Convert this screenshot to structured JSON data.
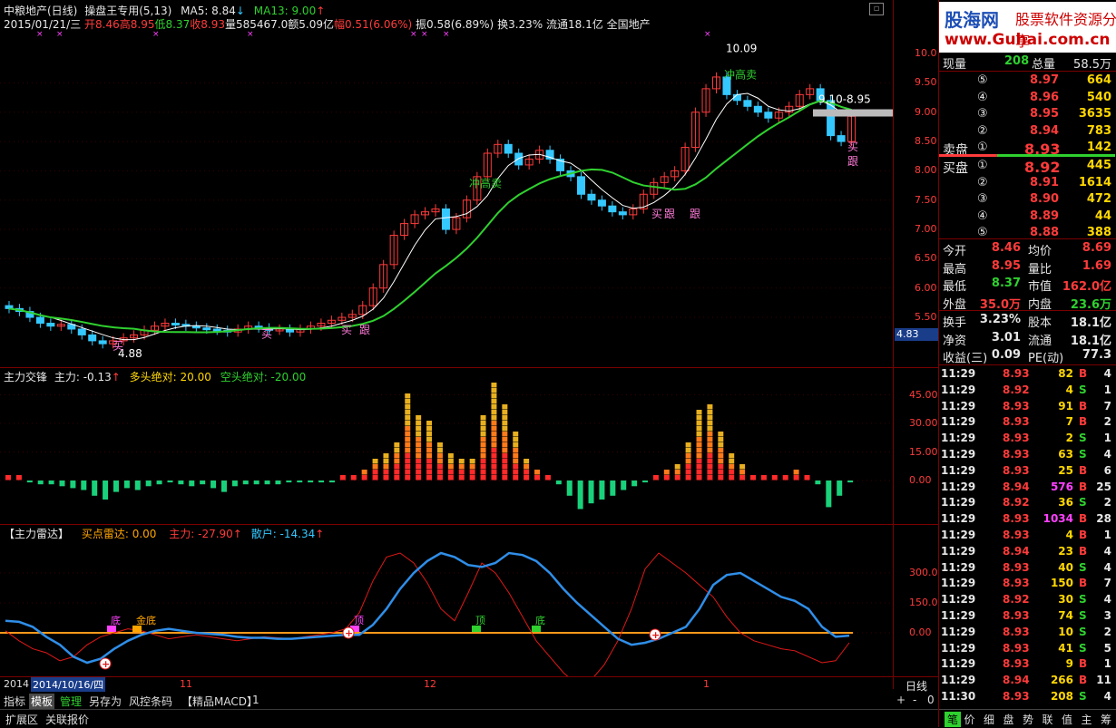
{
  "title": {
    "stock": "中粮地产(日线)",
    "template": "操盘王专用(5,13)",
    "ma5_label": "MA5: 8.84",
    "ma13_label": "MA13: 9.00"
  },
  "header2": {
    "date": "2015/01/21/三",
    "open": "开8.46",
    "high": "高8.95",
    "low": "低8.37",
    "close": "收8.93",
    "volume": "量585467.0",
    "amount": "额5.09亿",
    "change": "幅0.51(6.06%)",
    "amplitude": "振0.58(6.89%)",
    "turnover": "换3.23%",
    "float": "流通18.1亿",
    "sector": "全国地产"
  },
  "price_axis": [
    "10.0",
    "9.50",
    "9.00",
    "8.50",
    "8.00",
    "7.50",
    "7.00",
    "6.50",
    "6.00",
    "5.50"
  ],
  "price_current": "4.83",
  "annotations": {
    "high_peak": "10.09",
    "low_bottom": "4.88",
    "range": "9.10-8.95",
    "chonggaomai1": "冲高卖",
    "chonggaomai2": "冲高卖",
    "mai": "买",
    "gen": "跟"
  },
  "ind1": {
    "name": "主力交锋",
    "zhuli": "主力: -0.13",
    "duotou": "多头绝对: 20.00",
    "kongtou": "空头绝对: -20.00",
    "axis": [
      "45.00",
      "30.00",
      "15.00",
      "0.00"
    ]
  },
  "ind2": {
    "name": "【主力雷达】",
    "maidian": "买点雷达: 0.00",
    "zhuli": "主力: -27.90",
    "sanhu": "散户: -14.34",
    "axis": [
      "300.0",
      "150.0",
      "0.00"
    ],
    "markers": [
      "底",
      "金底",
      "顶",
      "顶",
      "底"
    ]
  },
  "date_axis": {
    "year": "2014",
    "cursor_date": "2014/10/16/四",
    "m11": "11",
    "m12": "12",
    "m1": "1",
    "period": "日线"
  },
  "toolbar": [
    "指标",
    "模板",
    "管理",
    "另存为",
    "风控条码",
    "【精品MACD】",
    "1"
  ],
  "toolbar_right": [
    "+",
    "-",
    "0"
  ],
  "bottom_tabs": [
    "扩展区",
    "关联报价"
  ],
  "side": {
    "logo": "股海网",
    "logo_sub": "股票软件资源分享",
    "url": "www.Guhai.com.cn",
    "xianliang_label": "现量",
    "xianliang": "208",
    "zongliang_label": "总量",
    "zongliang": "58.5万",
    "sell": [
      {
        "lvl": "⑤",
        "price": "8.97",
        "vol": "664"
      },
      {
        "lvl": "④",
        "price": "8.96",
        "vol": "540"
      },
      {
        "lvl": "③",
        "price": "8.95",
        "vol": "3635"
      },
      {
        "lvl": "②",
        "price": "8.94",
        "vol": "783"
      },
      {
        "lvl": "①",
        "price": "8.93",
        "vol": "142",
        "label": "卖盘"
      }
    ],
    "buy": [
      {
        "lvl": "①",
        "price": "8.92",
        "vol": "445",
        "label": "买盘"
      },
      {
        "lvl": "②",
        "price": "8.91",
        "vol": "1614"
      },
      {
        "lvl": "③",
        "price": "8.90",
        "vol": "472"
      },
      {
        "lvl": "④",
        "price": "8.89",
        "vol": "44"
      },
      {
        "lvl": "⑤",
        "price": "8.88",
        "vol": "388"
      }
    ],
    "stats": [
      {
        "l1": "今开",
        "v1": "8.46",
        "l2": "均价",
        "v2": "8.69"
      },
      {
        "l1": "最高",
        "v1": "8.95",
        "l2": "量比",
        "v2": "1.69"
      },
      {
        "l1": "最低",
        "v1": "8.37",
        "l2": "市值",
        "v2": "162.0亿"
      },
      {
        "l1": "外盘",
        "v1": "35.0万",
        "l2": "内盘",
        "v2": "23.6万"
      }
    ],
    "fin": [
      {
        "l1": "换手",
        "v1": "3.23%",
        "l2": "股本",
        "v2": "18.1亿"
      },
      {
        "l1": "净资",
        "v1": "3.01",
        "l2": "流通",
        "v2": "18.1亿"
      },
      {
        "l1": "收益(三)",
        "v1": "0.09",
        "l2": "PE(动)",
        "v2": "77.3"
      }
    ],
    "ticks": [
      [
        "11:29",
        "8.93",
        "82",
        "B",
        "4"
      ],
      [
        "11:29",
        "8.92",
        "4",
        "S",
        "1"
      ],
      [
        "11:29",
        "8.93",
        "91",
        "B",
        "7"
      ],
      [
        "11:29",
        "8.93",
        "7",
        "B",
        "2"
      ],
      [
        "11:29",
        "8.93",
        "2",
        "S",
        "1"
      ],
      [
        "11:29",
        "8.93",
        "63",
        "S",
        "4"
      ],
      [
        "11:29",
        "8.93",
        "25",
        "B",
        "6"
      ],
      [
        "11:29",
        "8.94",
        "576",
        "B",
        "25"
      ],
      [
        "11:29",
        "8.92",
        "36",
        "S",
        "2"
      ],
      [
        "11:29",
        "8.93",
        "1034",
        "B",
        "28"
      ],
      [
        "11:29",
        "8.93",
        "4",
        "B",
        "1"
      ],
      [
        "11:29",
        "8.94",
        "23",
        "B",
        "4"
      ],
      [
        "11:29",
        "8.93",
        "40",
        "S",
        "4"
      ],
      [
        "11:29",
        "8.93",
        "150",
        "B",
        "7"
      ],
      [
        "11:29",
        "8.92",
        "30",
        "S",
        "4"
      ],
      [
        "11:29",
        "8.93",
        "74",
        "S",
        "3"
      ],
      [
        "11:29",
        "8.93",
        "10",
        "S",
        "2"
      ],
      [
        "11:29",
        "8.93",
        "41",
        "S",
        "5"
      ],
      [
        "11:29",
        "8.93",
        "9",
        "B",
        "1"
      ],
      [
        "11:29",
        "8.94",
        "266",
        "B",
        "11"
      ],
      [
        "11:30",
        "8.93",
        "208",
        "S",
        "4"
      ]
    ],
    "tabs": [
      "笔",
      "价",
      "细",
      "盘",
      "势",
      "联",
      "值",
      "主",
      "筹"
    ]
  },
  "colors": {
    "up": "#ff3b3b",
    "down": "#35c8ff",
    "ma5": "#ffffff",
    "ma13": "#2fd12f",
    "bg": "#000000",
    "grid": "#7a0000"
  }
}
